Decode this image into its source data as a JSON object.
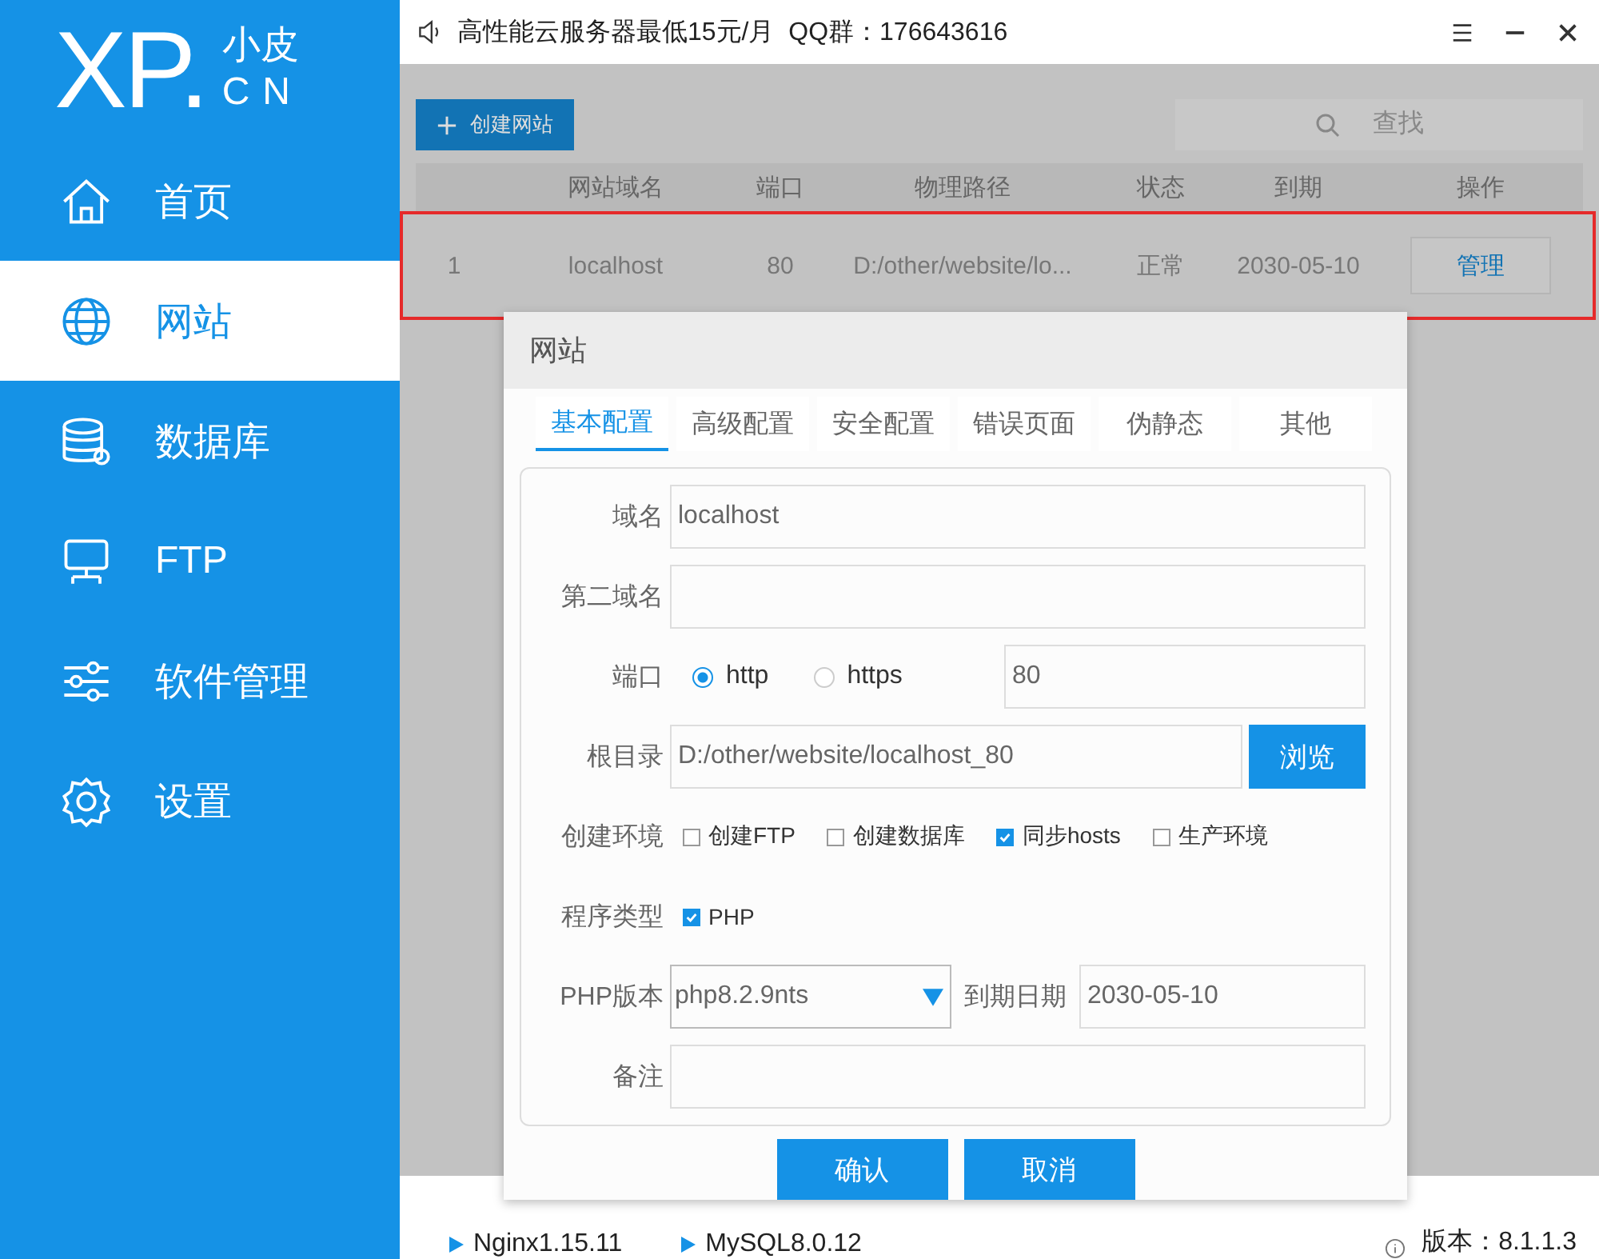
{
  "logo": {
    "main": "XP.",
    "top": "小皮",
    "bottom": "CN"
  },
  "sidebar": {
    "items": [
      {
        "label": "首页",
        "selected": false
      },
      {
        "label": "网站",
        "selected": true
      },
      {
        "label": "数据库",
        "selected": false
      },
      {
        "label": "FTP",
        "selected": false
      },
      {
        "label": "软件管理",
        "selected": false
      },
      {
        "label": "设置",
        "selected": false
      }
    ]
  },
  "title_bar": {
    "notice": "高性能云服务器最低15元/月  QQ群：176643616"
  },
  "toolbar": {
    "create_button": "创建网站",
    "search_placeholder": "查找"
  },
  "table": {
    "columns": [
      "",
      "网站域名",
      "端口",
      "物理路径",
      "状态",
      "到期",
      "操作"
    ],
    "rows": [
      {
        "cells": [
          "1",
          "localhost",
          "80",
          "D:/other/website/lo...",
          "正常",
          "2030-05-10"
        ],
        "action": "管理",
        "highlighted": true
      }
    ]
  },
  "dialog": {
    "title": "网站",
    "tabs": [
      {
        "label": "基本配置",
        "selected": true
      },
      {
        "label": "高级配置",
        "selected": false
      },
      {
        "label": "安全配置",
        "selected": false
      },
      {
        "label": "错误页面",
        "selected": false
      },
      {
        "label": "伪静态",
        "selected": false
      },
      {
        "label": "其他",
        "selected": false
      }
    ],
    "domain": {
      "label": "域名",
      "value": "localhost"
    },
    "second_domain": {
      "label": "第二域名"
    },
    "port": {
      "label": "端口",
      "options": [
        {
          "label": "http",
          "selected": true
        },
        {
          "label": "https",
          "selected": false
        }
      ],
      "value": "80"
    },
    "root": {
      "label": "根目录",
      "value": "D:/other/website/localhost_80",
      "button": "浏览"
    },
    "environment": {
      "label": "创建环境",
      "options": [
        {
          "label": "创建FTP",
          "checked": false
        },
        {
          "label": "创建数据库",
          "checked": false
        },
        {
          "label": "同步hosts",
          "checked": true
        },
        {
          "label": "生产环境",
          "checked": false
        }
      ]
    },
    "program_type": {
      "label": "程序类型",
      "options": [
        {
          "label": "PHP",
          "checked": true
        }
      ]
    },
    "php_version": {
      "label": "PHP版本",
      "value": "php8.2.9nts"
    },
    "expiry": {
      "label": "到期日期",
      "value": "2030-05-10"
    },
    "note": {
      "label": "备注"
    },
    "buttons": [
      "确认",
      "取消"
    ]
  },
  "status_bar": {
    "services": [
      "Nginx1.15.11",
      "MySQL8.0.12"
    ],
    "version": "版本：8.1.1.3"
  }
}
